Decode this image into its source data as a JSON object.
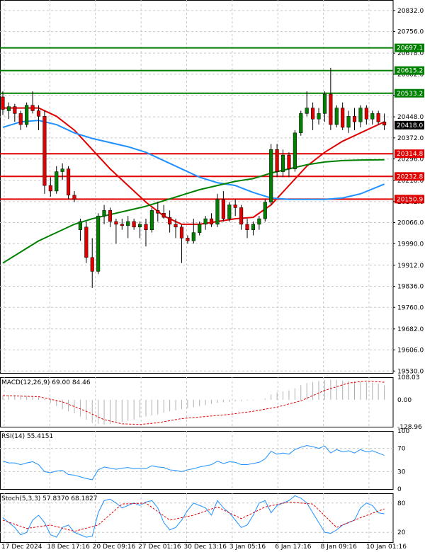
{
  "chart_data": [
    {
      "type": "candlestick",
      "title": "",
      "price_axis_ticks": [
        "20832.0",
        "20756.0",
        "20678.0",
        "20602.0",
        "20526.0",
        "20448.0",
        "20372.0",
        "20296.0",
        "20218.0",
        "20142.0",
        "20066.0",
        "19990.0",
        "19912.0",
        "19836.0",
        "19760.0",
        "19682.0",
        "19606.0",
        "19530.0"
      ],
      "ylim": [
        19523,
        20870
      ],
      "current_price": {
        "value": 20418.0,
        "label": "20418.0"
      },
      "levels": [
        {
          "value": 20697.1,
          "label": "20697.1",
          "color": "#008000"
        },
        {
          "value": 20615.2,
          "label": "20615.2",
          "color": "#008000"
        },
        {
          "value": 20533.2,
          "label": "20533.2",
          "color": "#008000"
        },
        {
          "value": 20314.8,
          "label": "20314.8",
          "color": "#e00000"
        },
        {
          "value": 20232.8,
          "label": "20232.8",
          "color": "#e00000"
        },
        {
          "value": 20150.9,
          "label": "20150.9",
          "color": "#e00000"
        }
      ],
      "time_labels": [
        "17 Dec 2024",
        "18 Dec 17:16",
        "20 Dec 09:16",
        "27 Dec 01:16",
        "30 Dec 13:16",
        "3 Jan 05:16",
        "6 Jan 17:16",
        "8 Jan 09:16",
        "10 Jan 01:16"
      ],
      "candles": [
        {
          "o": 20520,
          "h": 20540,
          "l": 20455,
          "c": 20475
        },
        {
          "o": 20470,
          "h": 20500,
          "l": 20440,
          "c": 20485
        },
        {
          "o": 20485,
          "h": 20495,
          "l": 20430,
          "c": 20460
        },
        {
          "o": 20460,
          "h": 20470,
          "l": 20400,
          "c": 20420
        },
        {
          "o": 20420,
          "h": 20500,
          "l": 20410,
          "c": 20490
        },
        {
          "o": 20490,
          "h": 20540,
          "l": 20460,
          "c": 20470
        },
        {
          "o": 20470,
          "h": 20490,
          "l": 20400,
          "c": 20450
        },
        {
          "o": 20450,
          "h": 20470,
          "l": 20170,
          "c": 20200
        },
        {
          "o": 20200,
          "h": 20230,
          "l": 20160,
          "c": 20180
        },
        {
          "o": 20180,
          "h": 20270,
          "l": 20170,
          "c": 20250
        },
        {
          "o": 20250,
          "h": 20280,
          "l": 20220,
          "c": 20260
        },
        {
          "o": 20260,
          "h": 20270,
          "l": 20150,
          "c": 20165
        },
        {
          "o": 20165,
          "h": 20180,
          "l": 20140,
          "c": 20150
        },
        {
          "o": 20040,
          "h": 20080,
          "l": 20000,
          "c": 20070
        },
        {
          "o": 20050,
          "h": 20070,
          "l": 19920,
          "c": 19940
        },
        {
          "o": 19940,
          "h": 20010,
          "l": 19830,
          "c": 19890
        },
        {
          "o": 19890,
          "h": 20100,
          "l": 19880,
          "c": 20090
        },
        {
          "o": 20090,
          "h": 20130,
          "l": 20060,
          "c": 20110
        },
        {
          "o": 20110,
          "h": 20120,
          "l": 20050,
          "c": 20070
        },
        {
          "o": 20070,
          "h": 20080,
          "l": 19990,
          "c": 20060
        },
        {
          "o": 20060,
          "h": 20080,
          "l": 20040,
          "c": 20055
        },
        {
          "o": 20055,
          "h": 20090,
          "l": 20010,
          "c": 20070
        },
        {
          "o": 20070,
          "h": 20080,
          "l": 20040,
          "c": 20050
        },
        {
          "o": 20050,
          "h": 20070,
          "l": 20010,
          "c": 20060
        },
        {
          "o": 20060,
          "h": 20080,
          "l": 19980,
          "c": 20040
        },
        {
          "o": 20040,
          "h": 20120,
          "l": 20030,
          "c": 20110
        },
        {
          "o": 20110,
          "h": 20140,
          "l": 20070,
          "c": 20100
        },
        {
          "o": 20100,
          "h": 20130,
          "l": 20080,
          "c": 20085
        },
        {
          "o": 20085,
          "h": 20110,
          "l": 20030,
          "c": 20060
        },
        {
          "o": 20060,
          "h": 20080,
          "l": 20010,
          "c": 20050
        },
        {
          "o": 20050,
          "h": 20060,
          "l": 19920,
          "c": 20010
        },
        {
          "o": 20010,
          "h": 20020,
          "l": 19990,
          "c": 20000
        },
        {
          "o": 20000,
          "h": 20080,
          "l": 19990,
          "c": 20030
        },
        {
          "o": 20030,
          "h": 20070,
          "l": 20020,
          "c": 20060
        },
        {
          "o": 20060,
          "h": 20090,
          "l": 20040,
          "c": 20080
        },
        {
          "o": 20080,
          "h": 20100,
          "l": 20050,
          "c": 20060
        },
        {
          "o": 20060,
          "h": 20170,
          "l": 20050,
          "c": 20150
        },
        {
          "o": 20150,
          "h": 20180,
          "l": 20070,
          "c": 20080
        },
        {
          "o": 20080,
          "h": 20140,
          "l": 20070,
          "c": 20130
        },
        {
          "o": 20130,
          "h": 20150,
          "l": 20090,
          "c": 20120
        },
        {
          "o": 20120,
          "h": 20130,
          "l": 20040,
          "c": 20060
        },
        {
          "o": 20060,
          "h": 20080,
          "l": 20010,
          "c": 20040
        },
        {
          "o": 20040,
          "h": 20070,
          "l": 20020,
          "c": 20060
        },
        {
          "o": 20060,
          "h": 20090,
          "l": 20040,
          "c": 20080
        },
        {
          "o": 20080,
          "h": 20150,
          "l": 20070,
          "c": 20140
        },
        {
          "o": 20140,
          "h": 20350,
          "l": 20130,
          "c": 20330
        },
        {
          "o": 20330,
          "h": 20350,
          "l": 20230,
          "c": 20250
        },
        {
          "o": 20250,
          "h": 20330,
          "l": 20230,
          "c": 20310
        },
        {
          "o": 20310,
          "h": 20320,
          "l": 20230,
          "c": 20260
        },
        {
          "o": 20260,
          "h": 20400,
          "l": 20250,
          "c": 20390
        },
        {
          "o": 20390,
          "h": 20470,
          "l": 20380,
          "c": 20460
        },
        {
          "o": 20460,
          "h": 20540,
          "l": 20450,
          "c": 20480
        },
        {
          "o": 20480,
          "h": 20500,
          "l": 20400,
          "c": 20440
        },
        {
          "o": 20440,
          "h": 20480,
          "l": 20420,
          "c": 20460
        },
        {
          "o": 20460,
          "h": 20540,
          "l": 20430,
          "c": 20530
        },
        {
          "o": 20530,
          "h": 20625,
          "l": 20400,
          "c": 20420
        },
        {
          "o": 20420,
          "h": 20490,
          "l": 20410,
          "c": 20480
        },
        {
          "o": 20480,
          "h": 20500,
          "l": 20400,
          "c": 20410
        },
        {
          "o": 20410,
          "h": 20470,
          "l": 20390,
          "c": 20450
        },
        {
          "o": 20450,
          "h": 20480,
          "l": 20400,
          "c": 20430
        },
        {
          "o": 20430,
          "h": 20490,
          "l": 20410,
          "c": 20480
        },
        {
          "o": 20480,
          "h": 20490,
          "l": 20420,
          "c": 20440
        },
        {
          "o": 20440,
          "h": 20470,
          "l": 20420,
          "c": 20460
        },
        {
          "o": 20460,
          "h": 20470,
          "l": 20420,
          "c": 20430
        },
        {
          "o": 20430,
          "h": 20460,
          "l": 20400,
          "c": 20418
        }
      ],
      "moving_averages": [
        {
          "color": "#e00000",
          "values": [
            [
              0,
              20480
            ],
            [
              3,
              20480
            ],
            [
              6,
              20480
            ],
            [
              9,
              20450
            ],
            [
              12,
              20400
            ],
            [
              15,
              20330
            ],
            [
              18,
              20260
            ],
            [
              21,
              20200
            ],
            [
              24,
              20140
            ],
            [
              27,
              20090
            ],
            [
              30,
              20060
            ],
            [
              33,
              20060
            ],
            [
              36,
              20070
            ],
            [
              39,
              20080
            ],
            [
              42,
              20085
            ],
            [
              45,
              20130
            ],
            [
              48,
              20200
            ],
            [
              51,
              20270
            ],
            [
              54,
              20320
            ],
            [
              57,
              20360
            ],
            [
              60,
              20390
            ],
            [
              64,
              20430
            ]
          ]
        },
        {
          "color": "#1e90ff",
          "values": [
            [
              0,
              20410
            ],
            [
              3,
              20430
            ],
            [
              6,
              20435
            ],
            [
              9,
              20420
            ],
            [
              12,
              20390
            ],
            [
              15,
              20370
            ],
            [
              18,
              20355
            ],
            [
              21,
              20340
            ],
            [
              24,
              20320
            ],
            [
              27,
              20290
            ],
            [
              30,
              20260
            ],
            [
              33,
              20230
            ],
            [
              36,
              20210
            ],
            [
              39,
              20200
            ],
            [
              42,
              20175
            ],
            [
              45,
              20155
            ],
            [
              48,
              20150
            ],
            [
              51,
              20150
            ],
            [
              54,
              20150
            ],
            [
              57,
              20155
            ],
            [
              60,
              20170
            ],
            [
              64,
              20205
            ]
          ]
        },
        {
          "color": "#008000",
          "values": [
            [
              0,
              19920
            ],
            [
              3,
              19960
            ],
            [
              6,
              20000
            ],
            [
              9,
              20030
            ],
            [
              12,
              20060
            ],
            [
              15,
              20080
            ],
            [
              18,
              20095
            ],
            [
              21,
              20110
            ],
            [
              24,
              20125
            ],
            [
              27,
              20145
            ],
            [
              30,
              20165
            ],
            [
              33,
              20185
            ],
            [
              36,
              20200
            ],
            [
              39,
              20215
            ],
            [
              42,
              20225
            ],
            [
              45,
              20245
            ],
            [
              48,
              20260
            ],
            [
              51,
              20275
            ],
            [
              54,
              20285
            ],
            [
              57,
              20290
            ],
            [
              60,
              20292
            ],
            [
              64,
              20293
            ]
          ]
        }
      ]
    },
    {
      "type": "histogram",
      "indicator_label": "MACD(12,26,9) 69.00 84.46",
      "axis_labels": [
        "108.03",
        "0.00",
        "-128.96"
      ],
      "ylim": [
        -128.96,
        108.03
      ],
      "macd": [
        20,
        22,
        24,
        22,
        18,
        15,
        12,
        5,
        -15,
        -30,
        -45,
        -55,
        -65,
        -80,
        -95,
        -110,
        -115,
        -118,
        -115,
        -110,
        -105,
        -100,
        -95,
        -85,
        -80,
        -75,
        -70,
        -62,
        -55,
        -50,
        -45,
        -40,
        -35,
        -30,
        -25,
        -20,
        -15,
        -12,
        -10,
        -8,
        -6,
        -4,
        -2,
        0,
        5,
        25,
        35,
        40,
        45,
        55,
        70,
        80,
        85,
        90,
        95,
        96,
        95,
        93,
        90,
        88,
        86,
        85,
        82,
        77,
        69
      ],
      "signal": [
        [
          0,
          20
        ],
        [
          6,
          15
        ],
        [
          10,
          -10
        ],
        [
          14,
          -55
        ],
        [
          17,
          -95
        ],
        [
          20,
          -115
        ],
        [
          23,
          -118
        ],
        [
          26,
          -110
        ],
        [
          30,
          -90
        ],
        [
          34,
          -80
        ],
        [
          38,
          -70
        ],
        [
          42,
          -55
        ],
        [
          46,
          -35
        ],
        [
          50,
          -5
        ],
        [
          54,
          45
        ],
        [
          58,
          80
        ],
        [
          61,
          90
        ],
        [
          64,
          84
        ]
      ]
    },
    {
      "type": "line",
      "indicator_label": "RSI(14) 55.4151",
      "axis_labels": [
        "100",
        "70",
        "30",
        "0"
      ],
      "ylim": [
        0,
        100
      ],
      "values": [
        48,
        45,
        45,
        42,
        45,
        47,
        42,
        30,
        28,
        31,
        32,
        25,
        24,
        21,
        18,
        16,
        33,
        38,
        36,
        34,
        36,
        37,
        35,
        36,
        35,
        40,
        38,
        37,
        33,
        32,
        30,
        33,
        35,
        38,
        40,
        42,
        48,
        44,
        47,
        46,
        42,
        42,
        44,
        46,
        52,
        65,
        60,
        62,
        60,
        68,
        72,
        75,
        73,
        70,
        74,
        62,
        68,
        64,
        66,
        62,
        68,
        64,
        66,
        62,
        58
      ]
    },
    {
      "type": "line",
      "indicator_label": "Stoch(5,3,3) 57.8370 68.1827",
      "axis_labels": [
        "80",
        "20"
      ],
      "ylim": [
        0,
        100
      ],
      "main": [
        50,
        40,
        30,
        15,
        20,
        45,
        55,
        40,
        15,
        10,
        30,
        35,
        20,
        15,
        10,
        12,
        60,
        85,
        88,
        80,
        70,
        75,
        80,
        75,
        82,
        85,
        70,
        40,
        25,
        30,
        45,
        65,
        80,
        75,
        70,
        55,
        85,
        70,
        60,
        45,
        30,
        35,
        55,
        80,
        85,
        60,
        75,
        80,
        85,
        95,
        90,
        80,
        60,
        40,
        20,
        18,
        25,
        35,
        40,
        45,
        70,
        80,
        75,
        60,
        58
      ],
      "signal": [
        [
          0,
          45
        ],
        [
          4,
          28
        ],
        [
          8,
          35
        ],
        [
          12,
          22
        ],
        [
          16,
          35
        ],
        [
          20,
          78
        ],
        [
          24,
          80
        ],
        [
          28,
          45
        ],
        [
          32,
          55
        ],
        [
          36,
          72
        ],
        [
          40,
          48
        ],
        [
          44,
          72
        ],
        [
          48,
          82
        ],
        [
          52,
          78
        ],
        [
          56,
          30
        ],
        [
          60,
          50
        ],
        [
          64,
          68
        ]
      ]
    }
  ]
}
